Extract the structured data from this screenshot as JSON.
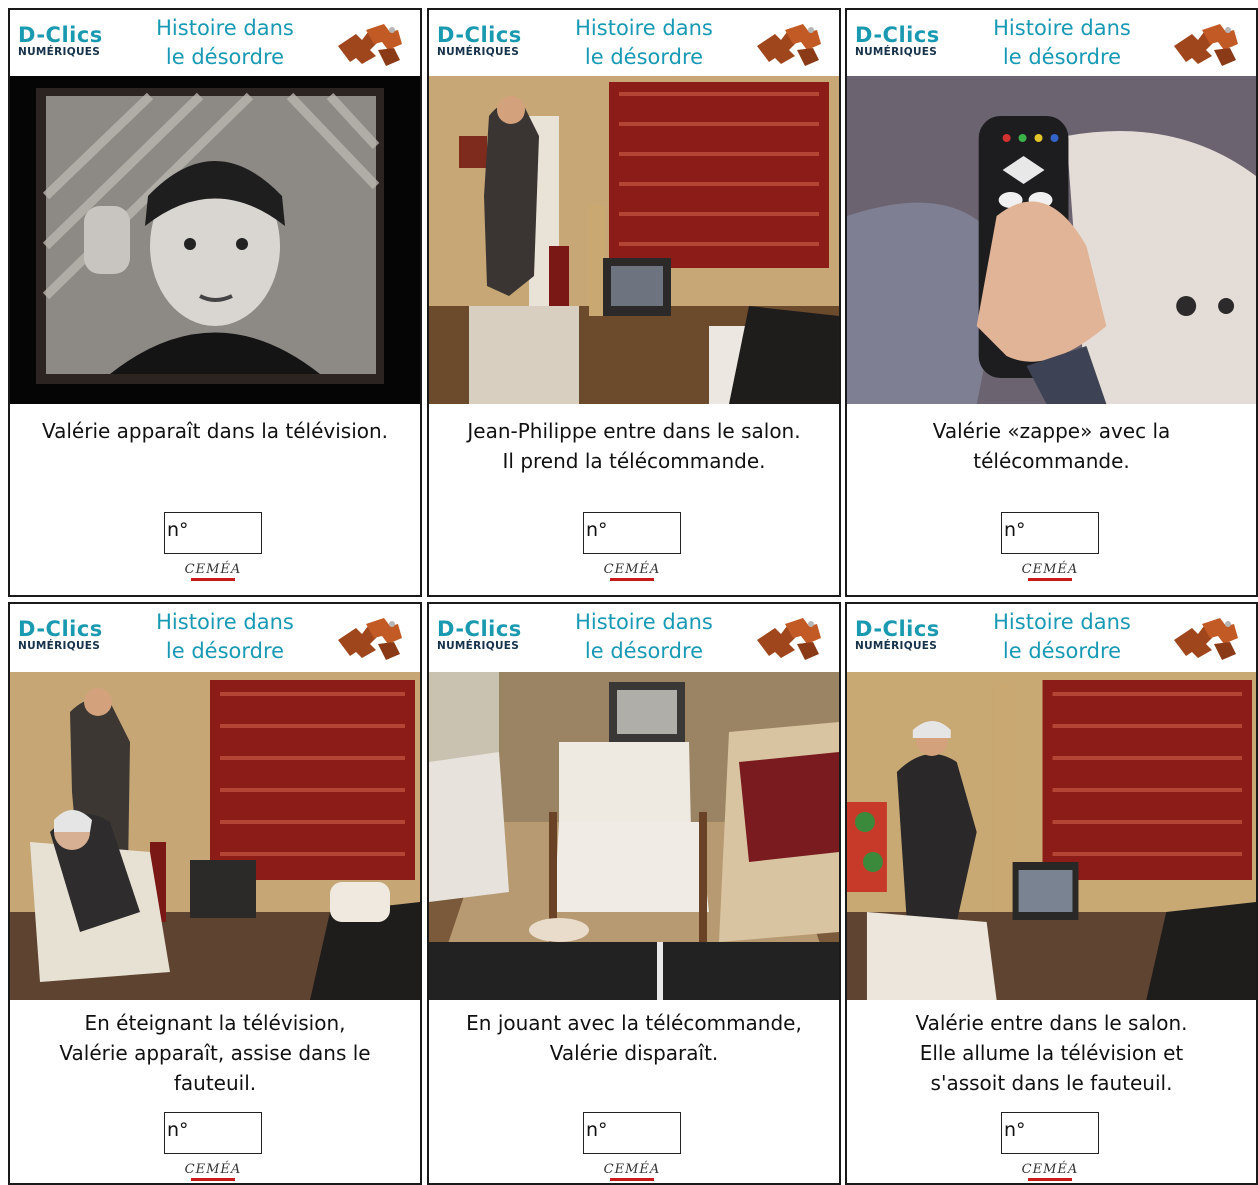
{
  "header": {
    "logo_main": "D-Clics",
    "logo_sub": "NUMÉRIQUES",
    "title_line1": "Histoire dans",
    "title_line2": "le désordre"
  },
  "cards": [
    {
      "caption": [
        "Valérie apparaît dans la télévision."
      ],
      "number_label": "n°",
      "footer_logo": "CEMÉA"
    },
    {
      "caption": [
        "Jean-Philippe entre dans le salon.",
        "Il prend la télécommande."
      ],
      "number_label": "n°",
      "footer_logo": "CEMÉA"
    },
    {
      "caption": [
        "Valérie «zappe» avec la",
        "télécommande."
      ],
      "number_label": "n°",
      "footer_logo": "CEMÉA"
    },
    {
      "caption": [
        "En éteignant la télévision,",
        "Valérie apparaît, assise dans le",
        "fauteuil."
      ],
      "number_label": "n°",
      "footer_logo": "CEMÉA"
    },
    {
      "caption": [
        "En jouant avec la télécommande,",
        "Valérie disparaît."
      ],
      "number_label": "n°",
      "footer_logo": "CEMÉA"
    },
    {
      "caption": [
        "Valérie entre dans le salon.",
        "Elle allume la télévision et",
        "s'assoit dans le fauteuil."
      ],
      "number_label": "n°",
      "footer_logo": "CEMÉA"
    }
  ],
  "colors": {
    "accent": "#1899b4",
    "logo_dark": "#16314a",
    "cemea_red": "#c91a1a"
  },
  "icons": {
    "puzzle": "puzzle-pieces-icon"
  }
}
